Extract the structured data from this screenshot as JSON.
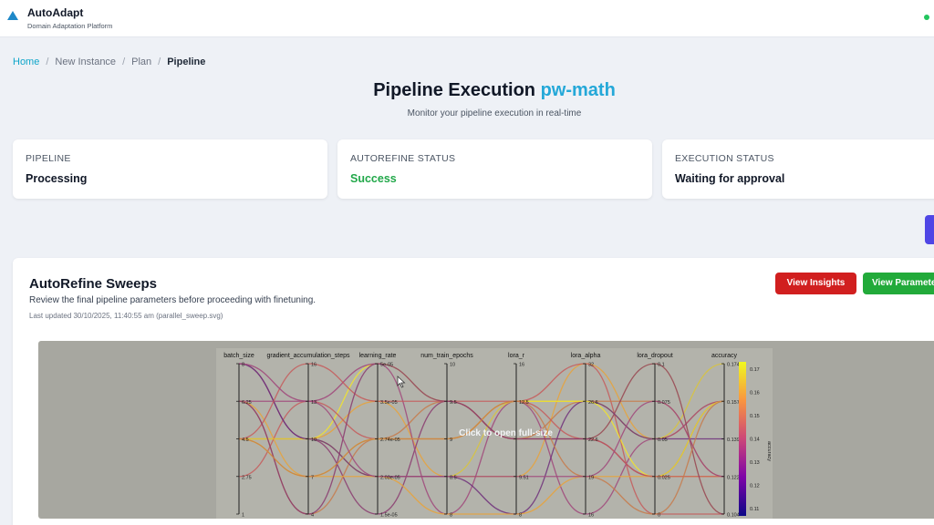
{
  "app": {
    "title": "AutoAdapt",
    "subtitle": "Domain Adaptation Platform"
  },
  "breadcrumb": {
    "home": "Home",
    "new_instance": "New Instance",
    "plan": "Plan",
    "current": "Pipeline",
    "separator": "/"
  },
  "page": {
    "title_prefix": "Pipeline Execution",
    "title_accent": "pw-math",
    "subtitle": "Monitor your pipeline execution in real-time"
  },
  "cards": [
    {
      "label": "PIPELINE",
      "value": "Processing"
    },
    {
      "label": "AUTOREFINE STATUS",
      "value": "Success"
    },
    {
      "label": "EXECUTION STATUS",
      "value": "Waiting for approval"
    }
  ],
  "sweeps": {
    "title": "AutoRefine Sweeps",
    "description": "Review the final pipeline parameters before proceeding with finetuning.",
    "updated": "Last updated 30/10/2025, 11:40:55 am (parallel_sweep.svg)",
    "insights_button": "View Insights",
    "params_button": "View Parameters",
    "overlay": "Click to open full-size"
  },
  "colors": {
    "accent": "#24a8d8",
    "success": "#22a84a",
    "insights": "#d11f1f",
    "params": "#22aa3a",
    "status_dot": "#22c55e"
  },
  "chart_data": {
    "type": "parallel-coordinates",
    "axes": [
      {
        "name": "batch_size",
        "ticks": [
          "8",
          "6.25",
          "4.5",
          "2.75",
          "1"
        ]
      },
      {
        "name": "gradient_accumulation_steps",
        "ticks": [
          "16",
          "13",
          "10",
          "7",
          "4"
        ]
      },
      {
        "name": "learning_rate",
        "ticks": [
          "5e-05",
          "3.5e-05",
          "2.74e-05",
          "2.03e-05",
          "1.5e-05"
        ]
      },
      {
        "name": "num_train_epochs",
        "ticks": [
          "10",
          "9.5",
          "9",
          "8.5",
          "8"
        ]
      },
      {
        "name": "lora_r",
        "ticks": [
          "16",
          "12.5",
          "",
          "9.51",
          "8"
        ]
      },
      {
        "name": "lora_alpha",
        "ticks": [
          "32",
          "26.6",
          "22.6",
          "19",
          "16"
        ]
      },
      {
        "name": "lora_dropout",
        "ticks": [
          "0.1",
          "0.075",
          "0.05",
          "0.025",
          "0"
        ]
      },
      {
        "name": "accuracy",
        "ticks": [
          "0.174",
          "0.157",
          "0.139",
          "0.122",
          "0.104"
        ]
      }
    ],
    "colorbar": {
      "label": "accuracy",
      "ticks": [
        "0.17",
        "0.16",
        "0.15",
        "0.14",
        "0.13",
        "0.12",
        "0.11"
      ]
    }
  }
}
